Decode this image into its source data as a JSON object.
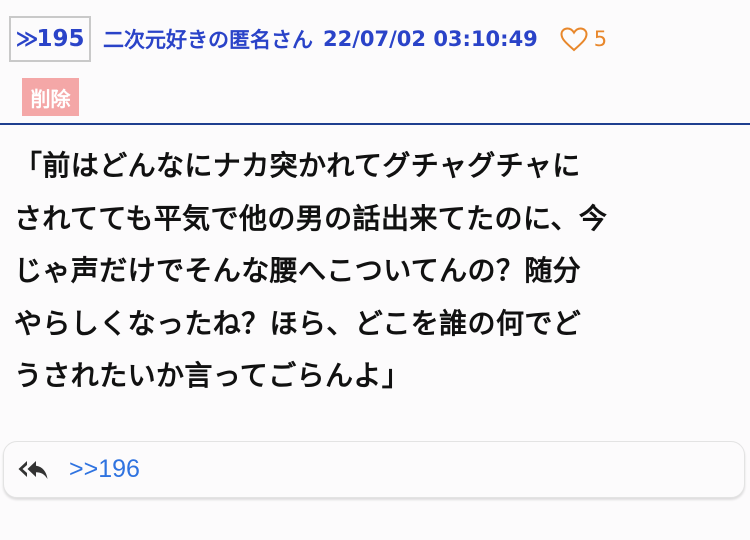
{
  "post": {
    "number": "195",
    "anchor_symbol": "≫",
    "author": "二次元好きの匿名さん",
    "datetime": "22/07/02 03:10:49",
    "like_icon": "heart-outline-icon",
    "like_count": "5",
    "delete_label": "削除",
    "body_lines": [
      "「前はどんなにナカ突かれてグチャグチャに",
      "されてても平気で他の男の話出来てたのに、今",
      "じゃ声だけでそんな腰へこついてんの？随分",
      "やらしくなったね？ほら、どこを誰の何でど",
      "うされたいか言ってごらんよ」"
    ],
    "reply_icon": "reply-all-icon",
    "reply_link": ">>196"
  },
  "colors": {
    "link_blue": "#2a43c8",
    "like_orange": "#e8872b",
    "delete_bg": "#f4a7a7",
    "divider": "#1f3f8f",
    "reply_link": "#2f73e0"
  }
}
